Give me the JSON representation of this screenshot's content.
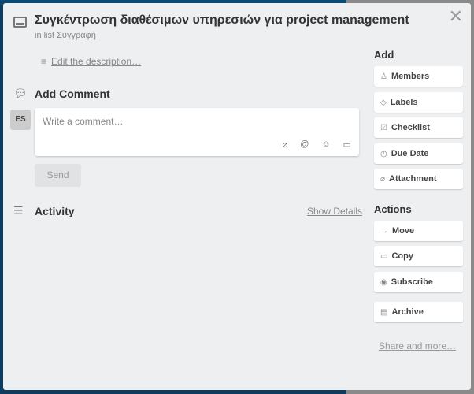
{
  "card": {
    "title": "Συγκέντρωση διαθέσιμων υπηρεσιών για project management",
    "in_list": "in list",
    "list_name": "Συγγραφή",
    "edit_description": "Edit the description…"
  },
  "comment": {
    "heading": "Add Comment",
    "avatar": "ES",
    "placeholder": "Write a comment…",
    "send": "Send"
  },
  "activity": {
    "heading": "Activity",
    "show_details": "Show Details"
  },
  "add": {
    "heading": "Add",
    "buttons": [
      {
        "label": "Members",
        "icon": "person-icon"
      },
      {
        "label": "Labels",
        "icon": "tag-icon"
      },
      {
        "label": "Checklist",
        "icon": "checkbox-icon"
      },
      {
        "label": "Due Date",
        "icon": "clock-icon"
      },
      {
        "label": "Attachment",
        "icon": "paperclip-icon"
      }
    ]
  },
  "actions": {
    "heading": "Actions",
    "buttons": [
      {
        "label": "Move",
        "icon": "arrow-right-icon"
      },
      {
        "label": "Copy",
        "icon": "card-icon"
      },
      {
        "label": "Subscribe",
        "icon": "eye-icon"
      },
      {
        "label": "Archive",
        "icon": "archive-icon"
      }
    ],
    "share": "Share and more…"
  }
}
